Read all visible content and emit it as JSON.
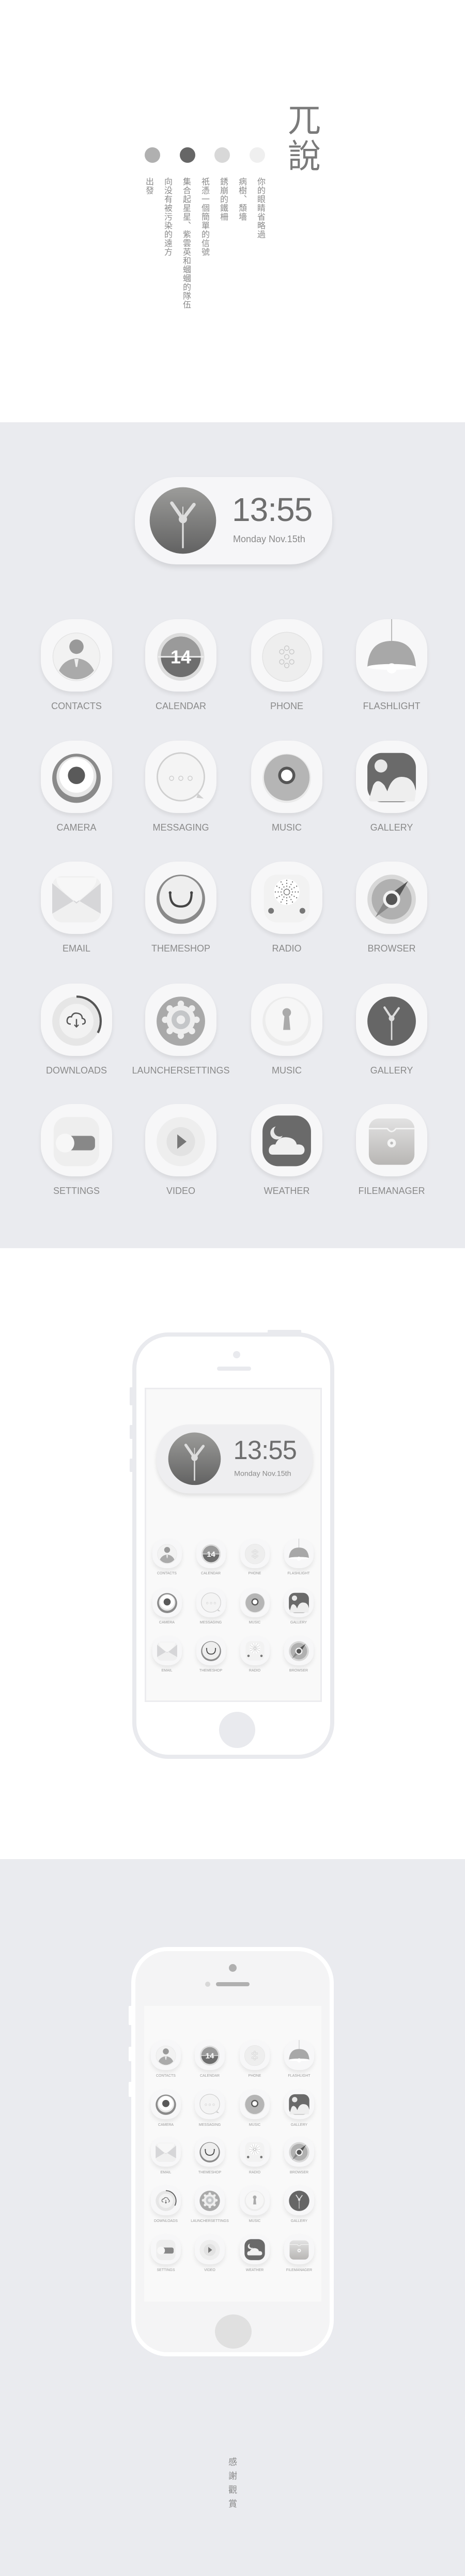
{
  "intro": {
    "title": "兀說",
    "dot_colors": [
      "#b0b0b0",
      "#666666",
      "#d8d8d8",
      "#efefef"
    ],
    "poem_lines": [
      "你的眼睛省略過",
      "病樹、頹墻",
      "銹崩的鐵柵",
      "祇憑一個簡單的信號",
      "集合起星星、紫雲英和蟈蟈的隊伍",
      "向没有被污染的遠方",
      "出發"
    ]
  },
  "clock": {
    "time": "13:55",
    "date": "Monday Nov.15th"
  },
  "calendar_day": "14",
  "apps": [
    {
      "label": "CONTACTS",
      "icon": "contacts-icon"
    },
    {
      "label": "CALENDAR",
      "icon": "calendar-icon"
    },
    {
      "label": "PHONE",
      "icon": "phone-icon"
    },
    {
      "label": "FLASHLIGHT",
      "icon": "flashlight-icon"
    },
    {
      "label": "CAMERA",
      "icon": "camera-icon"
    },
    {
      "label": "MESSAGING",
      "icon": "messaging-icon"
    },
    {
      "label": "MUSIC",
      "icon": "music-disc-icon"
    },
    {
      "label": "GALLERY",
      "icon": "gallery-icon"
    },
    {
      "label": "EMAIL",
      "icon": "email-icon"
    },
    {
      "label": "THEMESHOP",
      "icon": "themeshop-icon"
    },
    {
      "label": "RADIO",
      "icon": "radio-icon"
    },
    {
      "label": "BROWSER",
      "icon": "browser-icon"
    },
    {
      "label": "DOWNLOADS",
      "icon": "downloads-icon"
    },
    {
      "label": "LAUNCHERSETTINGS",
      "icon": "gear-icon"
    },
    {
      "label": "MUSIC",
      "icon": "keyhole-icon"
    },
    {
      "label": "GALLERY",
      "icon": "clock-icon"
    },
    {
      "label": "SETTINGS",
      "icon": "toggle-icon"
    },
    {
      "label": "VIDEO",
      "icon": "play-icon"
    },
    {
      "label": "WEATHER",
      "icon": "weather-icon"
    },
    {
      "label": "FILEMANAGER",
      "icon": "folder-icon"
    }
  ],
  "colors": {
    "background_gray": "#eaebef",
    "text_gray": "#8a8a8a",
    "dark_gray": "#6a6a6a"
  },
  "outro": "感謝觀賞"
}
